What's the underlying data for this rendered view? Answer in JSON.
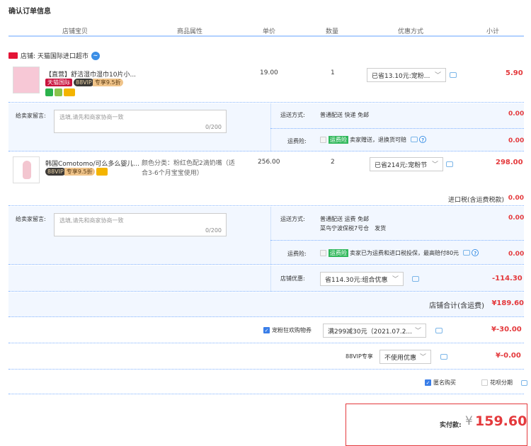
{
  "page": {
    "title": "确认订单信息"
  },
  "columns": [
    "店铺宝贝",
    "商品属性",
    "单价",
    "数量",
    "优惠方式",
    "小计"
  ],
  "shop": {
    "label": "店铺: 天猫国际进口超市"
  },
  "items": [
    {
      "name": "【直营】舒洁湿巾湿巾10片小...",
      "badges": {
        "tmall": "天猫国际",
        "vip": "88VIP",
        "zx": "专享9.5折"
      },
      "price": "19.00",
      "qty": "1",
      "discount": "已省13.10元:宠粉...",
      "subtotal": "5.90"
    },
    {
      "name": "韩国Comotomo/可么多么婴儿...",
      "badges": {
        "vip": "88VIP",
        "zx": "专享9.5折"
      },
      "attr": "颜色分类：粉红色配2滴奶嘴（适合3-6个月宝宝使用）",
      "price": "256.00",
      "qty": "2",
      "discount": "已省214元:宠粉节",
      "subtotal": "298.00"
    }
  ],
  "msg1": {
    "label": "给卖家留言:",
    "placeholder": "选填,请先和商家协商一致",
    "count": "0/200",
    "ship_label": "运送方式:",
    "ship_value": "普通配送 快递 免邮",
    "ship_fee": "0.00",
    "ins_label": "运费险:",
    "ins_badge": "运费险",
    "ins_text": "卖家赠送，退换货可赔",
    "ins_fee": "0.00"
  },
  "tax": {
    "label": "进口税(含运费税款)",
    "value": "0.00"
  },
  "msg2": {
    "label": "给卖家留言:",
    "placeholder": "选填,请先和商家协商一致",
    "count": "0/200",
    "ship_label": "运送方式:",
    "ship_value": "普通配送 运费 免邮",
    "ship_sub": "菜鸟宁波保税7号仓　发货",
    "ship_fee": "0.00",
    "ins_label": "运费险:",
    "ins_badge": "运费险",
    "ins_text": "卖家已为运费和进口税投保，最高赔付80元",
    "ins_fee": "0.00"
  },
  "shop_discount": {
    "label": "店铺优惠:",
    "value": "省114.30元:组合优惠",
    "amount": "-114.30"
  },
  "shop_total": {
    "label": "店铺合计(含运费)",
    "value": "¥189.60"
  },
  "coupon": {
    "label": "宠粉狂欢购物券",
    "value": "满299减30元（2021.07.2...",
    "amount": "¥-30.00"
  },
  "vip": {
    "label": "88VIP专享",
    "value": "不使用优惠",
    "amount": "¥-0.00"
  },
  "options": {
    "anonymous": "匿名购买",
    "huabei": "花呗分期"
  },
  "pay": {
    "label": "实付款:",
    "currency": "¥",
    "amount": "159.60"
  },
  "colors": {
    "accent_red": "#e4393c",
    "header_line": "#b2d1ff",
    "checkbox_blue": "#3a7ee8"
  }
}
